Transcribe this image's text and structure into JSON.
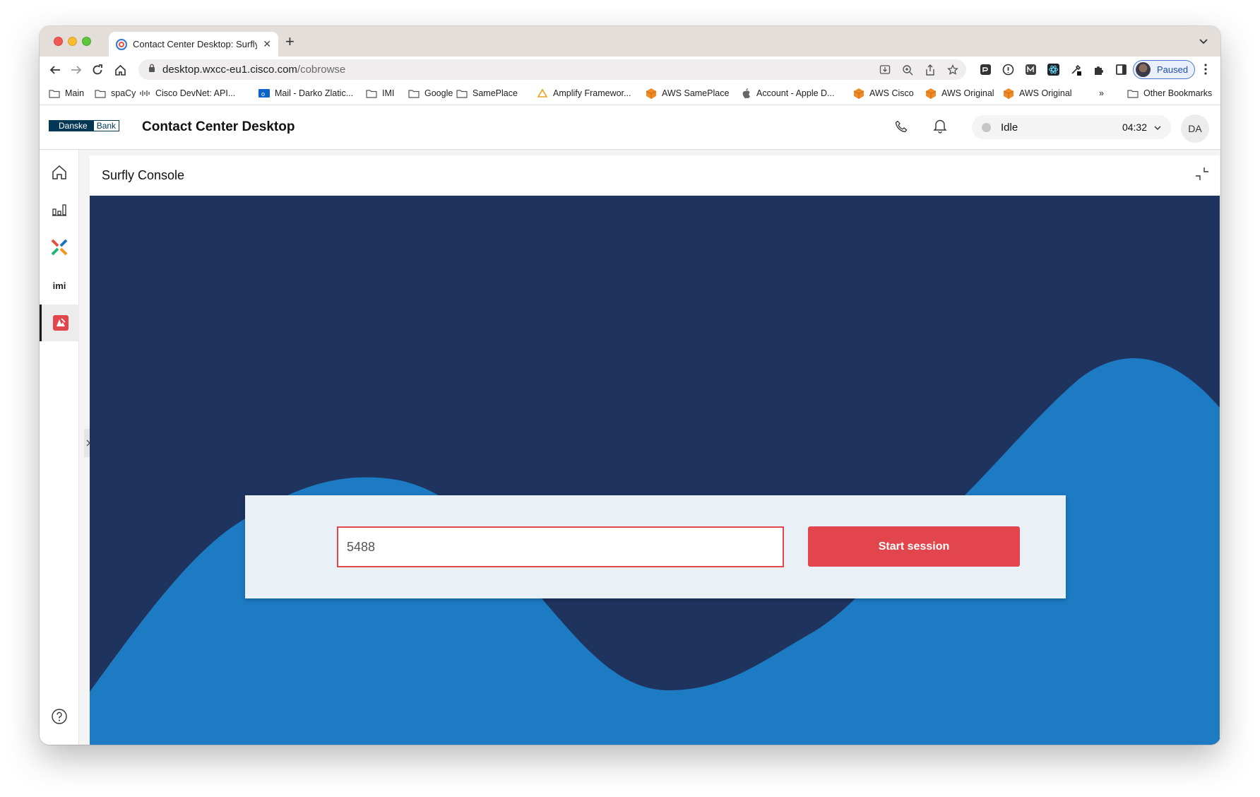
{
  "browser": {
    "tab_title": "Contact Center Desktop: Surfly",
    "new_tab_label": "+",
    "url_host": "desktop.wxcc-eu1.cisco.com",
    "url_path": "/cobrowse",
    "profile_status": "Paused"
  },
  "bookmarks": [
    {
      "label": "Main",
      "icon": "folder-icon"
    },
    {
      "label": "spaCy",
      "icon": "folder-icon"
    },
    {
      "label": "Cisco DevNet: API...",
      "icon": "cisco-icon"
    },
    {
      "label": "Mail - Darko Zlatic...",
      "icon": "outlook-icon"
    },
    {
      "label": "IMI",
      "icon": "folder-icon"
    },
    {
      "label": "Google",
      "icon": "folder-icon"
    },
    {
      "label": "SamePlace",
      "icon": "folder-icon"
    },
    {
      "label": "Amplify Framewor...",
      "icon": "amplify-icon"
    },
    {
      "label": "AWS SamePlace",
      "icon": "aws-icon"
    },
    {
      "label": "Account - Apple D...",
      "icon": "apple-icon"
    },
    {
      "label": "AWS Cisco",
      "icon": "aws-icon"
    },
    {
      "label": "AWS Original",
      "icon": "aws-icon"
    },
    {
      "label": "AWS Original",
      "icon": "aws-icon"
    }
  ],
  "bookmarks_overflow": "»",
  "other_bookmarks": "Other Bookmarks",
  "header": {
    "logo_part1": "Danske",
    "logo_part2": "Bank",
    "title": "Contact Center Desktop",
    "agent_state": "Idle",
    "state_timer": "04:32",
    "user_initials": "DA"
  },
  "sidebar": {
    "items": [
      {
        "name": "home",
        "icon": "home-icon"
      },
      {
        "name": "analytics",
        "icon": "bar-chart-icon"
      },
      {
        "name": "integration",
        "icon": "x-puzzle-icon"
      },
      {
        "name": "imi",
        "label": "imi"
      },
      {
        "name": "surfly",
        "icon": "surfly-icon",
        "active": true
      }
    ],
    "help_icon": "help-icon"
  },
  "panel": {
    "title": "Surfly Console"
  },
  "session": {
    "input_value": "5488",
    "start_label": "Start session"
  },
  "colors": {
    "dark_navy": "#1e335e",
    "wave_blue": "#1d7bc4",
    "accent_red": "#e2464c"
  }
}
